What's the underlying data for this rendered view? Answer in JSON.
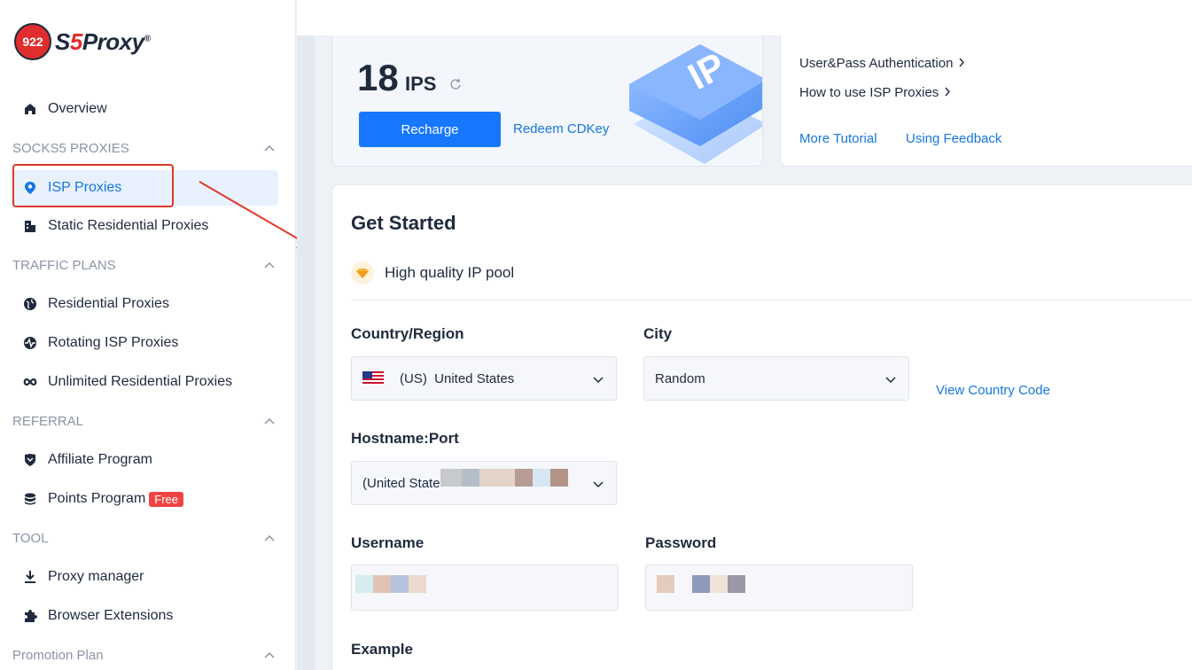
{
  "brand": {
    "logo_badge": "922",
    "name_pre": "S",
    "name_num": "5",
    "name_post": "Proxy",
    "reg": "®"
  },
  "sidebar": {
    "overview": "Overview",
    "sections": [
      {
        "title": "SOCKS5 PROXIES"
      },
      {
        "title": "TRAFFIC PLANS"
      },
      {
        "title": "REFERRAL"
      },
      {
        "title": "TOOL"
      },
      {
        "title": "Promotion Plan"
      }
    ],
    "items": {
      "isp": "ISP Proxies",
      "static_res": "Static Residential Proxies",
      "residential": "Residential Proxies",
      "rotating_isp": "Rotating ISP Proxies",
      "unlimited": "Unlimited Residential Proxies",
      "affiliate": "Affiliate Program",
      "points": "Points Program",
      "points_badge": "Free",
      "proxy_manager": "Proxy manager",
      "browser_ext": "Browser Extensions"
    }
  },
  "ip_card": {
    "count": "18",
    "unit": "IPS",
    "recharge": "Recharge",
    "redeem": "Redeem CDKey",
    "illustration_text": "IP"
  },
  "help_card": {
    "links": [
      "User&Pass Authentication",
      "How to use ISP Proxies"
    ],
    "more_tutorial": "More Tutorial",
    "feedback": "Using Feedback"
  },
  "get_started": {
    "title": "Get Started",
    "quality": "High quality IP pool",
    "country_label": "Country/Region",
    "country_value": "(US)  United States",
    "city_label": "City",
    "city_value": "Random",
    "view_code": "View Country Code",
    "hostname_label": "Hostname:Port",
    "hostname_value": "(United State",
    "username_label": "Username",
    "password_label": "Password",
    "example_label": "Example"
  },
  "colors": {
    "accent": "#1677ff",
    "highlight": "#e0392b",
    "badge": "#ef4444"
  }
}
